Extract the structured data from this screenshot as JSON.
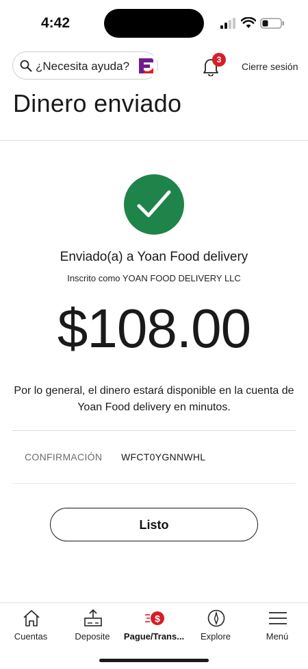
{
  "status_bar": {
    "time": "4:42"
  },
  "header": {
    "search_placeholder": "¿Necesita ayuda?",
    "notification_count": "3",
    "signout_label": "Cierre sesión"
  },
  "page": {
    "title": "Dinero enviado"
  },
  "confirmation": {
    "sent_to": "Enviado(a) a Yoan Food delivery",
    "registered_as": "Inscrito como YOAN FOOD DELIVERY LLC",
    "amount": "$108.00",
    "availability_note": "Por lo general, el dinero estará disponible en la cuenta de Yoan Food delivery en minutos.",
    "confirmation_label": "CONFIRMACIÓN",
    "confirmation_number": "WFCT0YGNNWHL",
    "done_label": "Listo"
  },
  "bottom_nav": {
    "items": [
      {
        "label": "Cuentas",
        "icon": "home-icon"
      },
      {
        "label": "Deposite",
        "icon": "deposit-icon"
      },
      {
        "label": "Pague/Trans...",
        "icon": "pay-transfer-icon",
        "active": true
      },
      {
        "label": "Explore",
        "icon": "compass-icon"
      },
      {
        "label": "Menú",
        "icon": "menu-icon"
      }
    ]
  },
  "colors": {
    "success_green": "#1e8449",
    "brand_red": "#d71e28",
    "brand_purple": "#6b1f8c"
  }
}
